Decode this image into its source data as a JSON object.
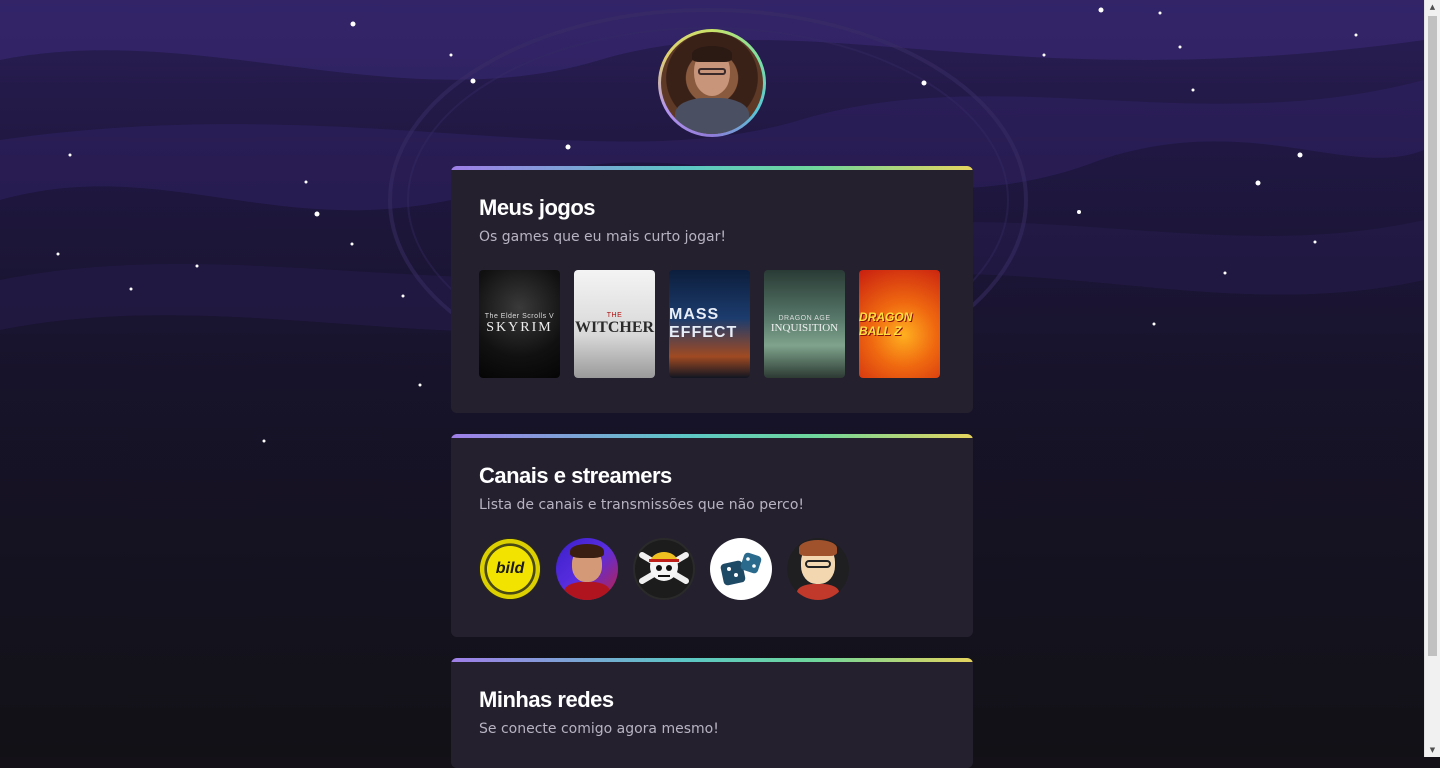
{
  "profile": {
    "avatar_icon": "profile-photo"
  },
  "games_section": {
    "title": "Meus jogos",
    "subtitle": "Os games que eu mais curto jogar!",
    "games": [
      {
        "cover_top": "The Elder Scrolls V",
        "cover_title": "SKYRIM"
      },
      {
        "cover_top": "THE",
        "cover_title": "WITCHER"
      },
      {
        "cover_top": "",
        "cover_title": "MASS EFFECT"
      },
      {
        "cover_top": "DRAGON AGE",
        "cover_title": "INQUISITION"
      },
      {
        "cover_top": "",
        "cover_title": "DRAGON BALL Z"
      }
    ]
  },
  "channels_section": {
    "title": "Canais e streamers",
    "subtitle": "Lista de canais e transmissões que não perco!",
    "channels": [
      {
        "logo_text": "bild"
      }
    ]
  },
  "networks_section": {
    "title": "Minhas redes",
    "subtitle": "Se conecte comigo agora mesmo!"
  },
  "colors": {
    "card_bg": "#25202e",
    "gradient_start": "#9f7ee8",
    "gradient_mid": "#5cc7c5",
    "gradient_end": "#e6d45e",
    "page_bg_top": "#2a1e55"
  }
}
